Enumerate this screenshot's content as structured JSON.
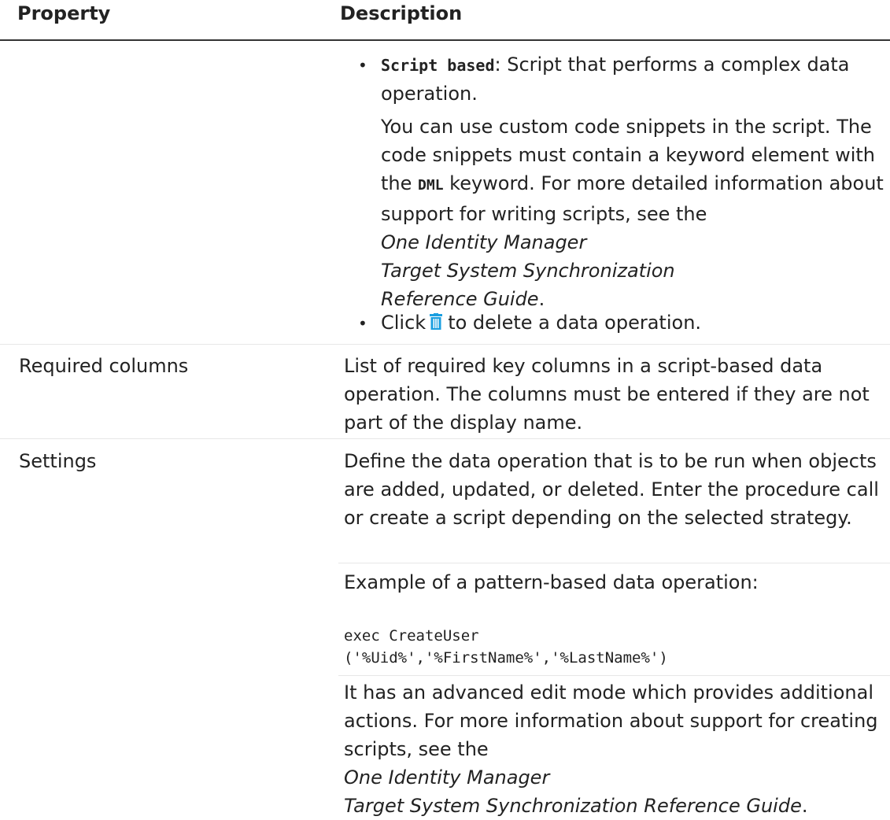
{
  "header": {
    "property": "Property",
    "description": "Description"
  },
  "script_item": {
    "bullet": "•",
    "code": "Script based",
    "text": ": Script that performs a complex data operation."
  },
  "script_para": {
    "p1": "You can use custom code snippets in the script. The code snippets must contain a keyword element with the ",
    "keyword": "DML",
    "p2": " keyword. For more detailed information about support for writing scripts, see the ",
    "guide_line1": "One Identity Manager",
    "guide_line2": "Target System Synchronization",
    "guide_line3": "Reference Guide",
    "end": "."
  },
  "delete_item": {
    "bullet": "•",
    "click": "Click",
    "text": "to delete a data operation.",
    "icon": "trash-icon",
    "icon_color": "#1b9fe0"
  },
  "rows": {
    "required_columns": {
      "property": "Required columns",
      "description": "List of required key columns in a script-based data operation. The columns must be entered if they are not part of the display name."
    },
    "settings": {
      "property": "Settings",
      "p1": "Define the data operation that is to be run when objects are added, updated, or deleted. Enter the procedure call or create a script depending on the selected strategy.",
      "p2": "Example of a pattern-based data operation:",
      "code_line1": "exec CreateUser",
      "code_line2": "('%Uid%','%FirstName%','%LastName%')",
      "p3": "It has an advanced edit mode which provides additional actions. For more information about support for creating scripts, see the",
      "guide_line1": "One Identity Manager",
      "guide_line2": "Target System Synchronization Reference Guide",
      "end": "."
    }
  }
}
